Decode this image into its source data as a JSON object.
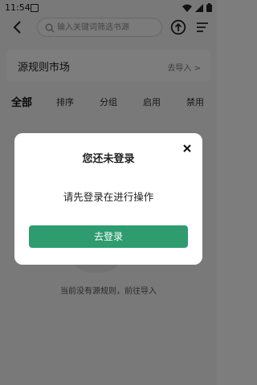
{
  "status_bar": {
    "time": "11:54"
  },
  "header": {
    "search_placeholder": "输入关键词筛选书源"
  },
  "market": {
    "title": "源规则市场",
    "import_label": "去导入 >"
  },
  "tabs": [
    {
      "label": "全部",
      "active": true
    },
    {
      "label": "排序",
      "active": false
    },
    {
      "label": "分组",
      "active": false
    },
    {
      "label": "启用",
      "active": false
    },
    {
      "label": "禁用",
      "active": false
    }
  ],
  "empty_state": {
    "text": "当前没有源规则，前往导入"
  },
  "dialog": {
    "title": "您还未登录",
    "message": "请先登录在进行操作",
    "button_label": "去登录",
    "accent_color": "#2e9c6f"
  }
}
